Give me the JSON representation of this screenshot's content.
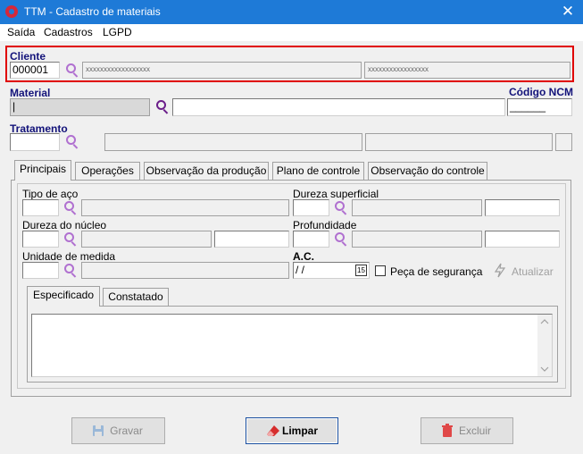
{
  "window": {
    "title": "TTM - Cadastro de materiais",
    "close": "✕"
  },
  "menu": [
    "Saída",
    "Cadastros",
    "LGPD"
  ],
  "cliente": {
    "label": "Cliente",
    "code": "000001",
    "name_mask": "xxxxxxxxxxxxxxxxxx",
    "doc_mask": "xxxxxxxxxxxxxxxxx"
  },
  "material": {
    "label": "Material",
    "value": "|",
    "ncm_label": "Código NCM",
    "ncm_value": "______"
  },
  "tratamento": {
    "label": "Tratamento"
  },
  "tabs": [
    "Principais",
    "Operações",
    "Observação da produção",
    "Plano de controle",
    "Observação do controle"
  ],
  "principais": {
    "tipo_aco": "Tipo de aço",
    "dureza_superficial": "Dureza superficial",
    "dureza_nucleo": "Dureza do núcleo",
    "profundidade": "Profundidade",
    "unidade_medida": "Unidade de medida",
    "ac_label": "A.C.",
    "ac_value": " / /",
    "calendar_day": "15",
    "peca_seguranca": "Peça de segurança",
    "atualizar": "Atualizar"
  },
  "subtabs": [
    "Especificado",
    "Constatado"
  ],
  "buttons": {
    "gravar": "Gravar",
    "limpar": "Limpar",
    "excluir": "Excluir"
  },
  "colors": {
    "titlebar": "#1e7ad7",
    "highlight": "#e00000",
    "label_blue": "#13137a",
    "search_icon": "#b070d0"
  }
}
